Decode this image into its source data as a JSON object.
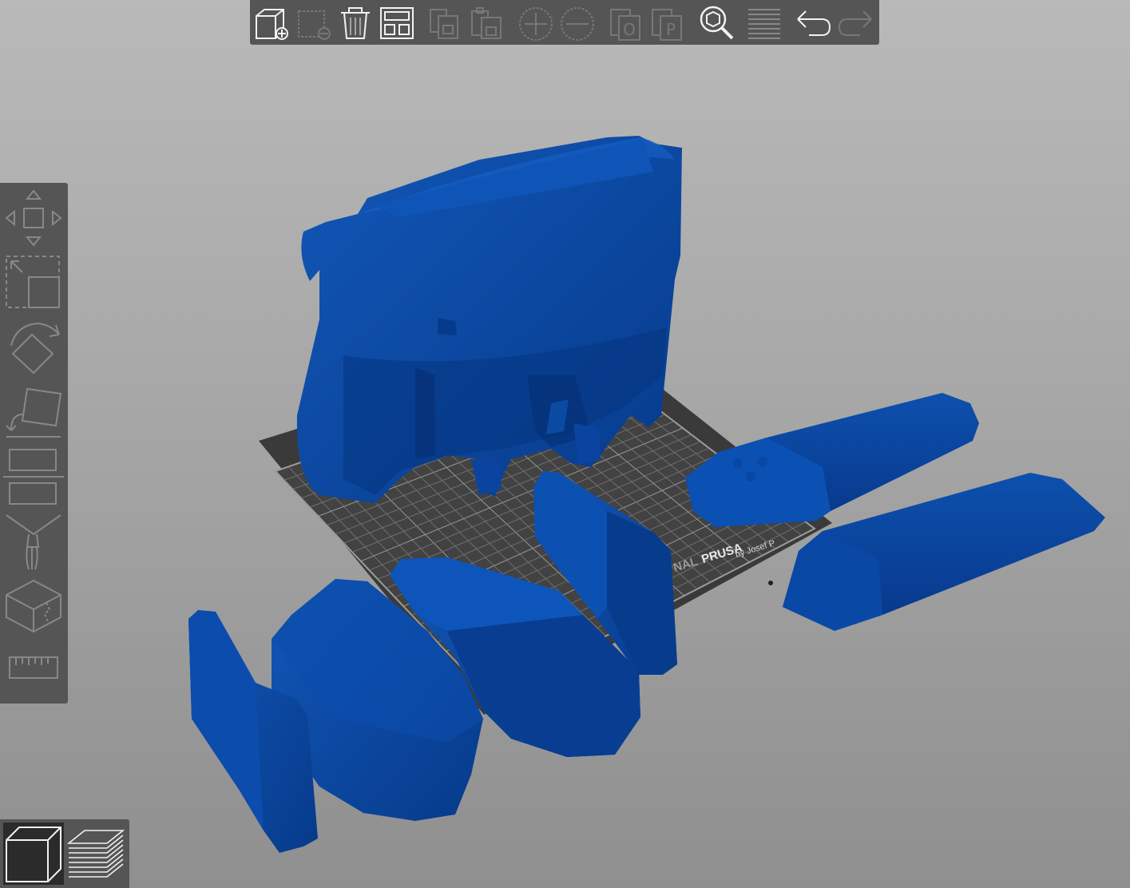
{
  "toolbar_top": {
    "buttons": [
      {
        "id": "add",
        "icon": "add-object-icon",
        "enabled": true
      },
      {
        "id": "delete",
        "icon": "delete-object-icon",
        "enabled": false
      },
      {
        "id": "delete_all",
        "icon": "trash-icon",
        "enabled": true
      },
      {
        "id": "arrange",
        "icon": "arrange-icon",
        "enabled": true
      },
      {
        "id": "copy",
        "icon": "copy-icon",
        "enabled": false
      },
      {
        "id": "paste",
        "icon": "paste-icon",
        "enabled": false
      },
      {
        "id": "add_instance",
        "icon": "plus-circle-icon",
        "enabled": false
      },
      {
        "id": "remove_instance",
        "icon": "minus-circle-icon",
        "enabled": false
      },
      {
        "id": "split_objects",
        "icon": "split-objects-icon",
        "label": "O",
        "enabled": false
      },
      {
        "id": "split_parts",
        "icon": "split-parts-icon",
        "label": "P",
        "enabled": false
      },
      {
        "id": "search",
        "icon": "search-icon",
        "enabled": true
      },
      {
        "id": "layers",
        "icon": "layers-editing-icon",
        "enabled": true
      },
      {
        "id": "undo",
        "icon": "undo-icon",
        "enabled": true
      },
      {
        "id": "redo",
        "icon": "redo-icon",
        "enabled": false
      }
    ]
  },
  "toolbar_left": {
    "tools": [
      {
        "id": "move",
        "icon": "move-icon"
      },
      {
        "id": "scale",
        "icon": "scale-icon"
      },
      {
        "id": "rotate",
        "icon": "rotate-icon"
      },
      {
        "id": "place_on_face",
        "icon": "place-on-face-icon"
      },
      {
        "id": "cut",
        "icon": "cut-icon"
      },
      {
        "id": "paint_supports",
        "icon": "paint-supports-icon"
      },
      {
        "id": "seam",
        "icon": "seam-painting-icon"
      },
      {
        "id": "measure",
        "icon": "measure-icon"
      }
    ]
  },
  "view_toggle": {
    "buttons": [
      {
        "id": "3d_view",
        "icon": "3d-cube-icon",
        "active": true
      },
      {
        "id": "preview",
        "icon": "layers-preview-icon",
        "active": false
      }
    ]
  },
  "bed": {
    "brand_prefix": "NAL",
    "brand": "PRUSA",
    "byline": "by Josef P",
    "surface_color": "#3a3a3a",
    "grid_color": "#8a8a8a"
  },
  "colors": {
    "model": "#0b4aa3",
    "model_dark": "#083a86",
    "toolbar_bg": "#555555",
    "icon_enabled": "#f2f2f2",
    "icon_disabled": "#777777"
  }
}
